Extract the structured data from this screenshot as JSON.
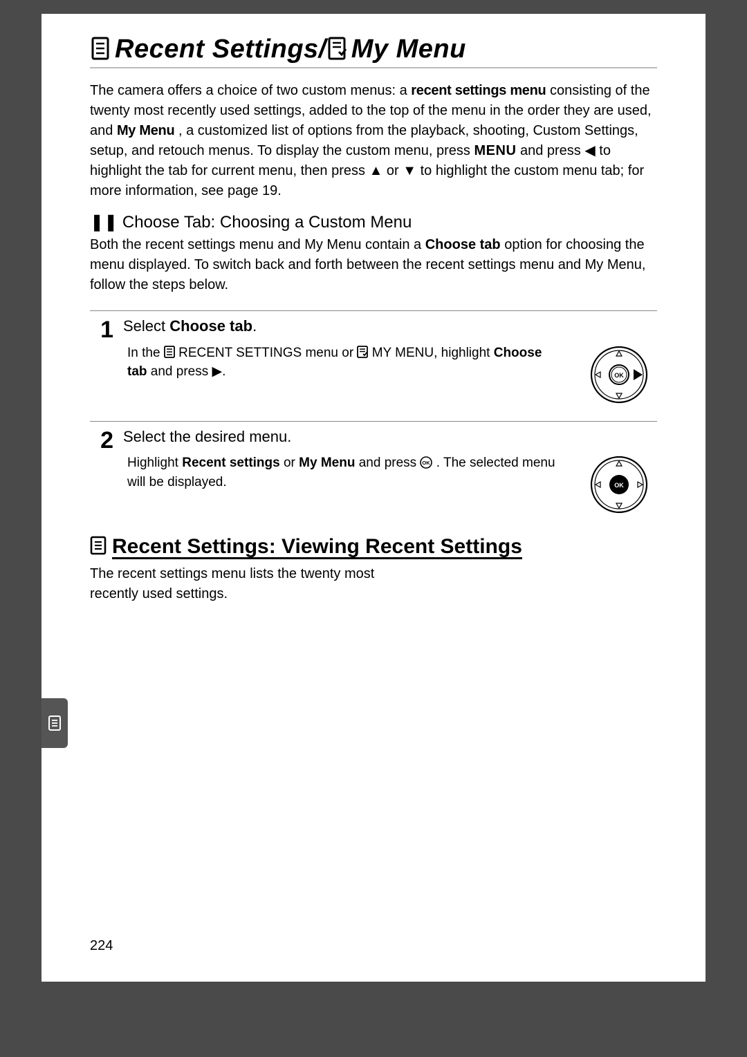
{
  "title": {
    "part1": "Recent Settings/",
    "part2": "My Menu"
  },
  "intro": {
    "t1": "The camera offers a choice of two custom menus: a ",
    "b1": "recent settings menu",
    "t2": " consisting of the twenty most recently used settings, added to the top of the menu in the order they are used, and ",
    "b2": "My Menu",
    "t3": ", a customized list of options from the playback, shooting, Custom Settings, setup, and retouch menus.  To display the custom menu, press ",
    "b3": "MENU",
    "t4": " and press ◀ to highlight the tab for current menu, then press ▲ or ▼ to highlight the custom menu tab; for more information, see page 19."
  },
  "choose_tab": {
    "icon": "❚❚",
    "heading_rest": " Choose Tab: Choosing a Custom Menu",
    "p1a": "Both the recent settings menu and My Menu contain a ",
    "p1b": "Choose tab",
    "p1c": " option for choosing the menu displayed.  To switch back and forth between the recent settings menu and My Menu, follow the steps below."
  },
  "steps": [
    {
      "num": "1",
      "title_a": "Select ",
      "title_b": "Choose tab",
      "title_c": ".",
      "text_a": "In the ",
      "text_b": " RECENT SETTINGS menu or ",
      "text_c": " MY MENU, highlight ",
      "text_bold": "Choose tab",
      "text_d": " and press ▶."
    },
    {
      "num": "2",
      "title_a": "Select the desired menu.",
      "title_b": "",
      "title_c": "",
      "text_a": "Highlight ",
      "text_bold1": "Recent settings",
      "text_b": " or ",
      "text_bold2": "My Menu",
      "text_c": " and press ",
      "text_d": ".  The selected menu will be displayed."
    }
  ],
  "section2": {
    "heading": "Recent Settings: Viewing Recent Settings",
    "p": "The recent settings menu lists the twenty most recently used settings."
  },
  "page_number": "224"
}
